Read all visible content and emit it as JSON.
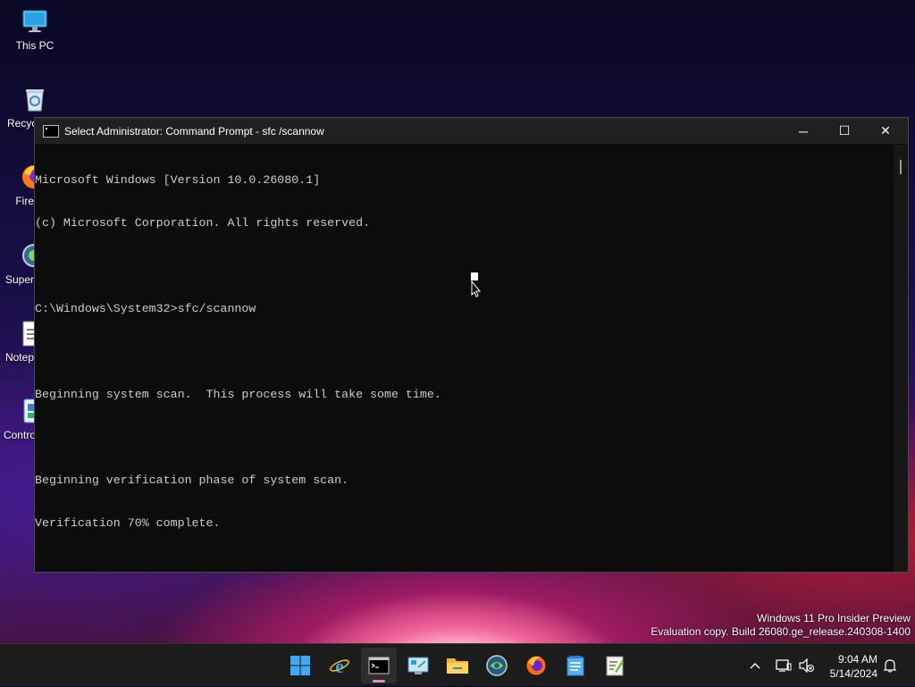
{
  "desktop": {
    "icons": [
      {
        "label": "This PC",
        "icon": "monitor-icon"
      },
      {
        "label": "Recyc",
        "icon": "recycle-bin-icon"
      },
      {
        "label": "Fire",
        "icon": "firefox-icon"
      },
      {
        "label": "Super",
        "icon": "superantispyware-icon"
      },
      {
        "label": "Notep",
        "icon": "notepad-icon"
      },
      {
        "label": "Contro",
        "icon": "control-panel-icon"
      }
    ]
  },
  "window": {
    "title": "Select Administrator: Command Prompt - sfc /scannow",
    "controls": {
      "minimize": "─",
      "maximize": "☐",
      "close": "✕"
    },
    "console_lines": [
      "Microsoft Windows [Version 10.0.26080.1]",
      "(c) Microsoft Corporation. All rights reserved.",
      "",
      "C:\\Windows\\System32>sfc/scannow",
      "",
      "Beginning system scan.  This process will take some time.",
      "",
      "Beginning verification phase of system scan.",
      "Verification 70% complete."
    ],
    "text_color": "#cccccc",
    "background_color": "#0c0c0c"
  },
  "watermark": {
    "line1": "Windows 11 Pro Insider Preview",
    "line2": "Evaluation copy. Build 26080.ge_release.240308-1400"
  },
  "taskbar": {
    "apps": [
      {
        "name": "start",
        "icon": "windows-logo-icon"
      },
      {
        "name": "internet-explorer",
        "icon": "ie-icon"
      },
      {
        "name": "command-prompt",
        "icon": "cmd-icon",
        "active": true
      },
      {
        "name": "control-panel",
        "icon": "control-panel-icon"
      },
      {
        "name": "file-explorer",
        "icon": "folder-icon"
      },
      {
        "name": "superantispyware",
        "icon": "globe-icon"
      },
      {
        "name": "firefox",
        "icon": "firefox-icon"
      },
      {
        "name": "notepad",
        "icon": "notepad-icon"
      },
      {
        "name": "notepad-plus",
        "icon": "notepad-plus-icon"
      }
    ],
    "tray": {
      "chevron": "^",
      "time": "9:04 AM",
      "date": "5/14/2024"
    },
    "accent_color": "#e48fb0"
  }
}
